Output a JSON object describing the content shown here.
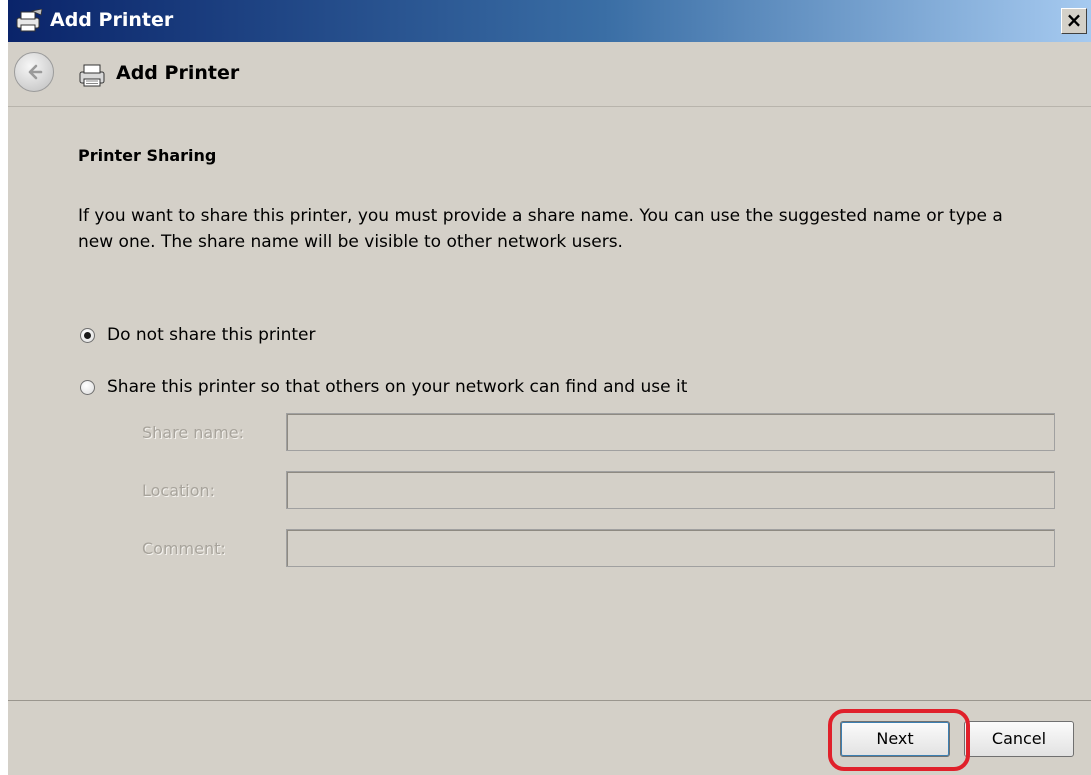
{
  "window": {
    "title": "Add Printer",
    "close_label": "×"
  },
  "nav": {
    "title": "Add Printer"
  },
  "content": {
    "heading": "Printer Sharing",
    "description": "If you want to share this printer, you must provide a share name. You can use the suggested name or type a new one. The share name will be visible to other network users.",
    "options": [
      {
        "label": "Do not share this printer",
        "checked": true
      },
      {
        "label": "Share this printer so that others on your network can find and use it",
        "checked": false
      }
    ],
    "fields": [
      {
        "label": "Share name:",
        "value": ""
      },
      {
        "label": "Location:",
        "value": ""
      },
      {
        "label": "Comment:",
        "value": ""
      }
    ]
  },
  "footer": {
    "next_label": "Next",
    "cancel_label": "Cancel"
  },
  "colors": {
    "highlight": "#e0202a",
    "dialog_background": "#d4d0c8",
    "title_gradient_start": "#0a246a"
  }
}
